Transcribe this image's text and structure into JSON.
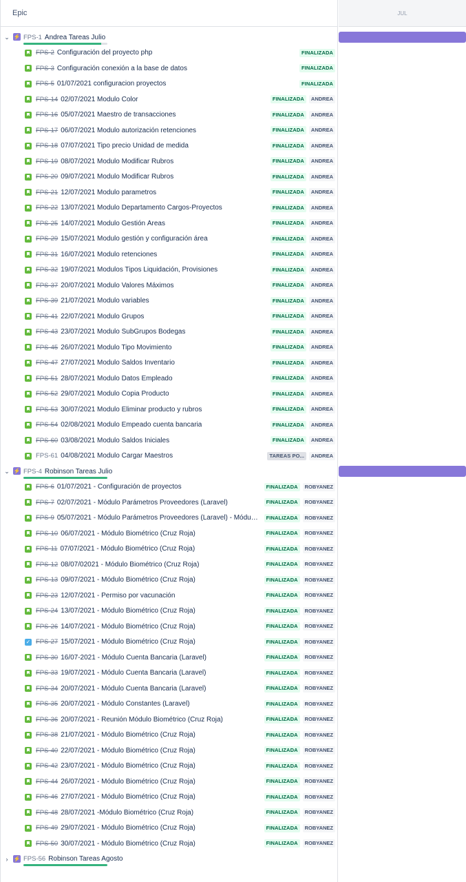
{
  "header": {
    "epic_label": "Epic",
    "month": "JUL"
  },
  "epics": [
    {
      "key": "FPS-1",
      "title": "Andrea Tareas Julio",
      "expanded": true,
      "chevron": "⌄",
      "progress": 0.93,
      "issues": [
        {
          "key": "FPS-2",
          "summary": "Configuración del proyecto php",
          "status": "FINALIZADA",
          "assignee": "",
          "icon": "story"
        },
        {
          "key": "FPS-3",
          "summary": "Configuración conexión a la base de datos",
          "status": "FINALIZADA",
          "assignee": "",
          "icon": "story"
        },
        {
          "key": "FPS-5",
          "summary": "01/07/2021 configuracion proyectos",
          "status": "FINALIZADA",
          "assignee": "",
          "icon": "story"
        },
        {
          "key": "FPS-14",
          "summary": "02/07/2021 Modulo Color",
          "status": "FINALIZADA",
          "assignee": "ANDREA",
          "icon": "story"
        },
        {
          "key": "FPS-16",
          "summary": "05/07/2021 Maestro de transacciones",
          "status": "FINALIZADA",
          "assignee": "ANDREA",
          "icon": "story"
        },
        {
          "key": "FPS-17",
          "summary": "06/07/2021 Modulo autorización retenciones",
          "status": "FINALIZADA",
          "assignee": "ANDREA",
          "icon": "story"
        },
        {
          "key": "FPS-18",
          "summary": "07/07/2021 Tipo precio Unidad de medida",
          "status": "FINALIZADA",
          "assignee": "ANDREA",
          "icon": "story"
        },
        {
          "key": "FPS-19",
          "summary": "08/07/2021 Modulo Modificar Rubros",
          "status": "FINALIZADA",
          "assignee": "ANDREA",
          "icon": "story"
        },
        {
          "key": "FPS-20",
          "summary": "09/07/2021 Modulo Modificar Rubros",
          "status": "FINALIZADA",
          "assignee": "ANDREA",
          "icon": "story"
        },
        {
          "key": "FPS-21",
          "summary": "12/07/2021 Modulo parametros",
          "status": "FINALIZADA",
          "assignee": "ANDREA",
          "icon": "story"
        },
        {
          "key": "FPS-22",
          "summary": "13/07/2021 Modulo Departamento Cargos-Proyectos",
          "status": "FINALIZADA",
          "assignee": "ANDREA",
          "icon": "story"
        },
        {
          "key": "FPS-25",
          "summary": "14/07/2021 Modulo Gestión Áreas",
          "status": "FINALIZADA",
          "assignee": "ANDREA",
          "icon": "story"
        },
        {
          "key": "FPS-29",
          "summary": "15/07/2021 Modulo gestión y configuración área",
          "status": "FINALIZADA",
          "assignee": "ANDREA",
          "icon": "story"
        },
        {
          "key": "FPS-31",
          "summary": "16/07/2021 Modulo retenciones",
          "status": "FINALIZADA",
          "assignee": "ANDREA",
          "icon": "story"
        },
        {
          "key": "FPS-32",
          "summary": "19/07/2021 Modulos Tipos Liquidación, Provisiones",
          "status": "FINALIZADA",
          "assignee": "ANDREA",
          "icon": "story"
        },
        {
          "key": "FPS-37",
          "summary": "20/07/2021 Modulo Valores Máximos",
          "status": "FINALIZADA",
          "assignee": "ANDREA",
          "icon": "story"
        },
        {
          "key": "FPS-39",
          "summary": "21/07/2021 Modulo variables",
          "status": "FINALIZADA",
          "assignee": "ANDREA",
          "icon": "story"
        },
        {
          "key": "FPS-41",
          "summary": "22/07/2021 Modulo Grupos",
          "status": "FINALIZADA",
          "assignee": "ANDREA",
          "icon": "story"
        },
        {
          "key": "FPS-43",
          "summary": "23/07/2021 Modulo SubGrupos Bodegas",
          "status": "FINALIZADA",
          "assignee": "ANDREA",
          "icon": "story"
        },
        {
          "key": "FPS-45",
          "summary": "26/07/2021 Modulo Tipo Movimiento",
          "status": "FINALIZADA",
          "assignee": "ANDREA",
          "icon": "story"
        },
        {
          "key": "FPS-47",
          "summary": "27/07/2021 Modulo Saldos Inventario",
          "status": "FINALIZADA",
          "assignee": "ANDREA",
          "icon": "story"
        },
        {
          "key": "FPS-51",
          "summary": "28/07/2021 Modulo Datos Empleado",
          "status": "FINALIZADA",
          "assignee": "ANDREA",
          "icon": "story"
        },
        {
          "key": "FPS-52",
          "summary": "29/07/2021 Modulo Copia Producto",
          "status": "FINALIZADA",
          "assignee": "ANDREA",
          "icon": "story"
        },
        {
          "key": "FPS-53",
          "summary": "30/07/2021 Modulo Eliminar producto y rubros",
          "status": "FINALIZADA",
          "assignee": "ANDREA",
          "icon": "story"
        },
        {
          "key": "FPS-54",
          "summary": "02/08/2021 Modulo Empeado cuenta bancaria",
          "status": "FINALIZADA",
          "assignee": "ANDREA",
          "icon": "story"
        },
        {
          "key": "FPS-60",
          "summary": "03/08/2021 Modulo Saldos Iniciales",
          "status": "FINALIZADA",
          "assignee": "ANDREA",
          "icon": "story"
        },
        {
          "key": "FPS-61",
          "summary": "04/08/2021 Modulo Cargar Maestros",
          "status": "TAREAS PO...",
          "assignee": "ANDREA",
          "icon": "story",
          "open": true
        }
      ]
    },
    {
      "key": "FPS-4",
      "title": "Robinson Tareas Julio",
      "expanded": true,
      "chevron": "⌄",
      "progress": 1.0,
      "issues": [
        {
          "key": "FPS-6",
          "summary": "01/07/2021 - Configuración de proyectos",
          "status": "FINALIZADA",
          "assignee": "ROBYANEZ",
          "icon": "story"
        },
        {
          "key": "FPS-7",
          "summary": "02/07/2021 - Módulo Parámetros Proveedores (Laravel)",
          "status": "FINALIZADA",
          "assignee": "ROBYANEZ",
          "icon": "story"
        },
        {
          "key": "FPS-9",
          "summary": "05/07/2021 - Módulo Parámetros Proveedores (Laravel) - Módulo...",
          "status": "FINALIZADA",
          "assignee": "ROBYANEZ",
          "icon": "story"
        },
        {
          "key": "FPS-10",
          "summary": "06/07/2021 - Módulo Biométrico (Cruz Roja)",
          "status": "FINALIZADA",
          "assignee": "ROBYANEZ",
          "icon": "story"
        },
        {
          "key": "FPS-11",
          "summary": "07/07/2021 - Módulo Biométrico (Cruz Roja)",
          "status": "FINALIZADA",
          "assignee": "ROBYANEZ",
          "icon": "story"
        },
        {
          "key": "FPS-12",
          "summary": "08/07/02021 - Módulo Biométrico (Cruz Roja)",
          "status": "FINALIZADA",
          "assignee": "ROBYANEZ",
          "icon": "story"
        },
        {
          "key": "FPS-13",
          "summary": "09/07/2021 - Módulo Biométrico (Cruz Roja)",
          "status": "FINALIZADA",
          "assignee": "ROBYANEZ",
          "icon": "story"
        },
        {
          "key": "FPS-23",
          "summary": "12/07/2021 - Permiso por vacunación",
          "status": "FINALIZADA",
          "assignee": "ROBYANEZ",
          "icon": "story"
        },
        {
          "key": "FPS-24",
          "summary": "13/07/2021 - Módulo Biométrico (Cruz Roja)",
          "status": "FINALIZADA",
          "assignee": "ROBYANEZ",
          "icon": "story"
        },
        {
          "key": "FPS-26",
          "summary": "14/07/2021 - Módulo Biométrico (Cruz Roja)",
          "status": "FINALIZADA",
          "assignee": "ROBYANEZ",
          "icon": "story"
        },
        {
          "key": "FPS-27",
          "summary": "15/07/2021 - Módulo Biométrico (Cruz Roja)",
          "status": "FINALIZADA",
          "assignee": "ROBYANEZ",
          "icon": "task"
        },
        {
          "key": "FPS-30",
          "summary": "16/07-2021 - Módulo Cuenta Bancaria (Laravel)",
          "status": "FINALIZADA",
          "assignee": "ROBYANEZ",
          "icon": "story"
        },
        {
          "key": "FPS-33",
          "summary": "19/07/2021 - Módulo Cuenta Bancaria (Laravel)",
          "status": "FINALIZADA",
          "assignee": "ROBYANEZ",
          "icon": "story"
        },
        {
          "key": "FPS-34",
          "summary": "20/07/2021 - Módulo Cuenta Bancaria (Laravel)",
          "status": "FINALIZADA",
          "assignee": "ROBYANEZ",
          "icon": "story"
        },
        {
          "key": "FPS-35",
          "summary": "20/07/2021 - Módulo Constantes (Laravel)",
          "status": "FINALIZADA",
          "assignee": "ROBYANEZ",
          "icon": "story"
        },
        {
          "key": "FPS-36",
          "summary": "20/07/2021 - Reunión Módulo Biométrico (Cruz Roja)",
          "status": "FINALIZADA",
          "assignee": "ROBYANEZ",
          "icon": "story"
        },
        {
          "key": "FPS-38",
          "summary": "21/07/2021 - Módulo Biométrico (Cruz Roja)",
          "status": "FINALIZADA",
          "assignee": "ROBYANEZ",
          "icon": "story"
        },
        {
          "key": "FPS-40",
          "summary": "22/07/2021 - Módulo Biométrico (Cruz Roja)",
          "status": "FINALIZADA",
          "assignee": "ROBYANEZ",
          "icon": "story"
        },
        {
          "key": "FPS-42",
          "summary": "23/07/2021 - Módulo Biométrico (Cruz Roja)",
          "status": "FINALIZADA",
          "assignee": "ROBYANEZ",
          "icon": "story"
        },
        {
          "key": "FPS-44",
          "summary": "26/07/2021 - Módulo Biométrico (Cruz Roja)",
          "status": "FINALIZADA",
          "assignee": "ROBYANEZ",
          "icon": "story"
        },
        {
          "key": "FPS-46",
          "summary": "27/07/2021 - Módulo Biométrico (Cruz Roja)",
          "status": "FINALIZADA",
          "assignee": "ROBYANEZ",
          "icon": "story"
        },
        {
          "key": "FPS-48",
          "summary": "28/07/2021 -Módulo Biométrico (Cruz Roja)",
          "status": "FINALIZADA",
          "assignee": "ROBYANEZ",
          "icon": "story"
        },
        {
          "key": "FPS-49",
          "summary": "29/07/2021 - Módulo Biométrico (Cruz Roja)",
          "status": "FINALIZADA",
          "assignee": "ROBYANEZ",
          "icon": "story"
        },
        {
          "key": "FPS-50",
          "summary": "30/07/2021 - Módulo Biométrico (Cruz Roja)",
          "status": "FINALIZADA",
          "assignee": "ROBYANEZ",
          "icon": "story"
        }
      ]
    },
    {
      "key": "FPS-56",
      "title": "Robinson Tareas Agosto",
      "expanded": false,
      "chevron": "›",
      "progress": 1.0,
      "issues": []
    }
  ],
  "colors": {
    "epic": "#8777d9",
    "story": "#63ba3c",
    "task": "#4bade8",
    "done_bg": "#e3fcef",
    "done_fg": "#006644"
  }
}
